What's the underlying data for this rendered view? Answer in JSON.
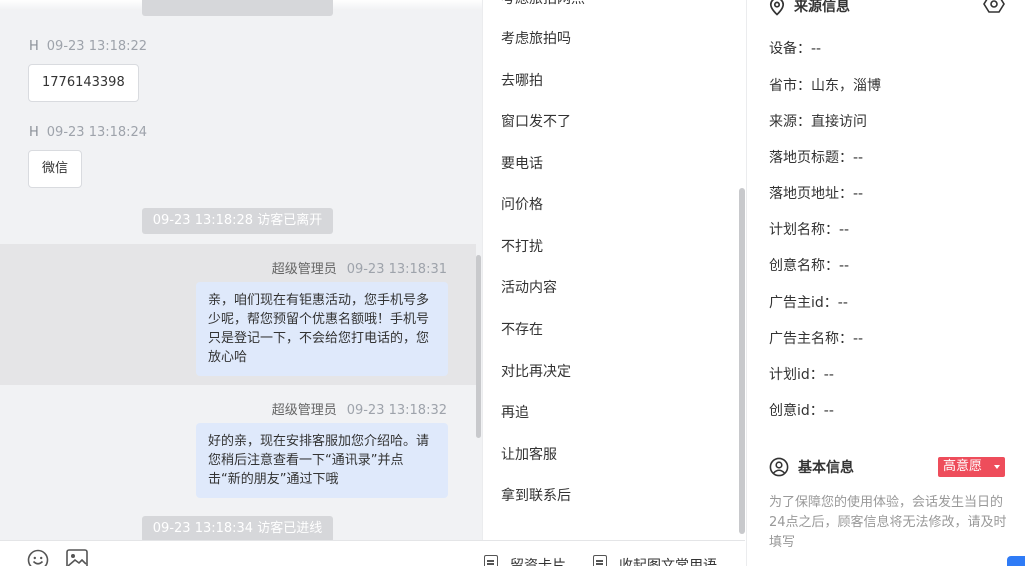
{
  "chat": {
    "messages": [
      {
        "sender": "H",
        "time": "09-23 13:18:22",
        "text": "1776143398"
      },
      {
        "sender": "H",
        "time": "09-23 13:18:24",
        "text": "微信"
      }
    ],
    "system_left": "09-23 13:18:28 访客已离开",
    "replies": [
      {
        "sender": "超级管理员",
        "time": "09-23 13:18:31",
        "text": "亲，咱们现在有钜惠活动，您手机号多少呢，帮您预留个优惠名额哦！手机号只是登记一下，不会给您打电话的，您放心哈"
      },
      {
        "sender": "超级管理员",
        "time": "09-23 13:18:32",
        "text": "好的亲，现在安排客服加您介绍哈。请您稍后注意查看一下“通讯录”并点击“新的朋友”通过下哦"
      }
    ],
    "system_online": "09-23 13:18:34 访客已进线"
  },
  "toolbar": {
    "emoji_icon": "smiley-icon",
    "image_icon": "image-icon",
    "card_label": "留资卡片",
    "collapse_label": "收起图文常用语"
  },
  "quick_replies": {
    "partial_top": "考虑旅拍网点",
    "items": [
      "考虑旅拍吗",
      "去哪拍",
      "窗口发不了",
      "要电话",
      "问价格",
      "不打扰",
      "活动内容",
      "不存在",
      "对比再决定",
      "再追",
      "让加客服",
      "拿到联系后"
    ]
  },
  "info": {
    "source_title": "来源信息",
    "source_icon": "location-pin-icon",
    "settings_icon": "gear-icon",
    "fields": [
      "设备：--",
      "省市：山东，淄博",
      "来源：直接访问",
      "落地页标题：--",
      "落地页地址：--",
      "计划名称：--",
      "创意名称：--",
      "广告主id：--",
      "广告主名称：--",
      "计划id：--",
      "创意id：--"
    ],
    "basic_title": "基本信息",
    "basic_icon": "user-circle-icon",
    "badge": "高意愿",
    "badge_color": "#ee4d5b",
    "hint": "为了保障您的使用体验，会话发生当日的24点之后，顾客信息将无法修改，请及时填写"
  }
}
